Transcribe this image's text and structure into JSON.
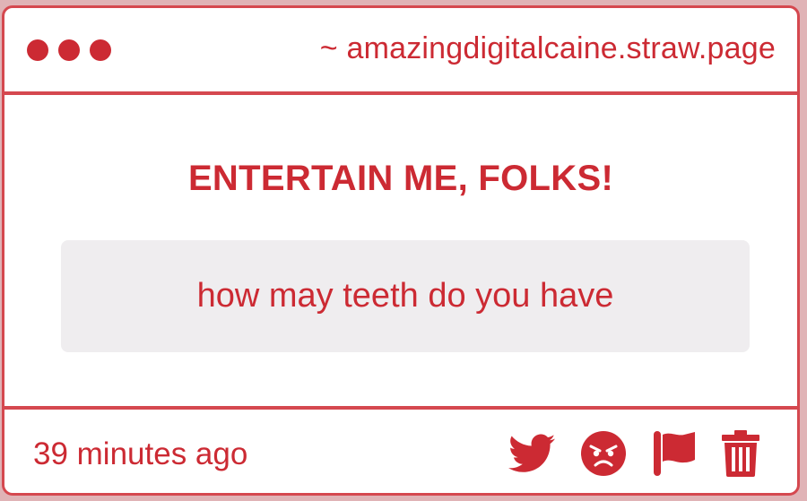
{
  "header": {
    "site_url": "~ amazingdigitalcaine.straw.page",
    "window_dots_color": "#cc2a33"
  },
  "post": {
    "title": "ENTERTAIN ME, FOLKS!",
    "message": "how may teeth do you have"
  },
  "footer": {
    "timestamp": "39 minutes ago",
    "actions": [
      "twitter-icon",
      "angry-face-icon",
      "flag-icon",
      "trash-icon"
    ]
  },
  "colors": {
    "accent": "#cc2a33",
    "border": "#d5484f",
    "message_bg": "#efedef"
  }
}
